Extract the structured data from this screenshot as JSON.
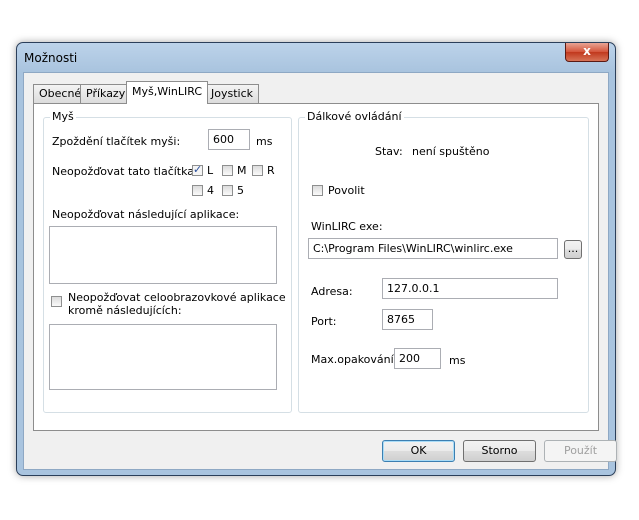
{
  "window": {
    "title": "Možnosti",
    "close_label": "x"
  },
  "tabs": [
    {
      "label": "Obecné"
    },
    {
      "label": "Příkazy"
    },
    {
      "label": "Myš,WinLIRC"
    },
    {
      "label": "Joystick"
    }
  ],
  "mouse": {
    "group_label": "Myš",
    "delay_label": "Zpoždění tlačítek myši:",
    "delay_value": "600",
    "delay_unit": "ms",
    "no_delay_buttons_label": "Neopožďovat tato tlačítka:",
    "buttons": [
      {
        "label": "L",
        "checked": true
      },
      {
        "label": "M",
        "checked": false
      },
      {
        "label": "R",
        "checked": false
      },
      {
        "label": "4",
        "checked": false
      },
      {
        "label": "5",
        "checked": false
      }
    ],
    "no_delay_apps_label": "Neopožďovat následující aplikace:",
    "fullscreen_label_1": "Neopožďovat celoobrazovkové aplikace",
    "fullscreen_label_2": "kromě následujících:",
    "fullscreen_checked": false
  },
  "remote": {
    "group_label": "Dálkové ovládání",
    "status_label": "Stav:",
    "status_value": "není spuštěno",
    "enable_label": "Povolit",
    "enable_checked": false,
    "exe_label": "WinLIRC exe:",
    "exe_value": "C:\\Program Files\\WinLIRC\\winlirc.exe",
    "browse_label": "...",
    "address_label": "Adresa:",
    "address_value": "127.0.0.1",
    "port_label": "Port:",
    "port_value": "8765",
    "max_repeat_label": "Max.opakování:",
    "max_repeat_value": "200",
    "max_repeat_unit": "ms"
  },
  "buttons": {
    "ok": "OK",
    "cancel": "Storno",
    "apply": "Použít"
  }
}
